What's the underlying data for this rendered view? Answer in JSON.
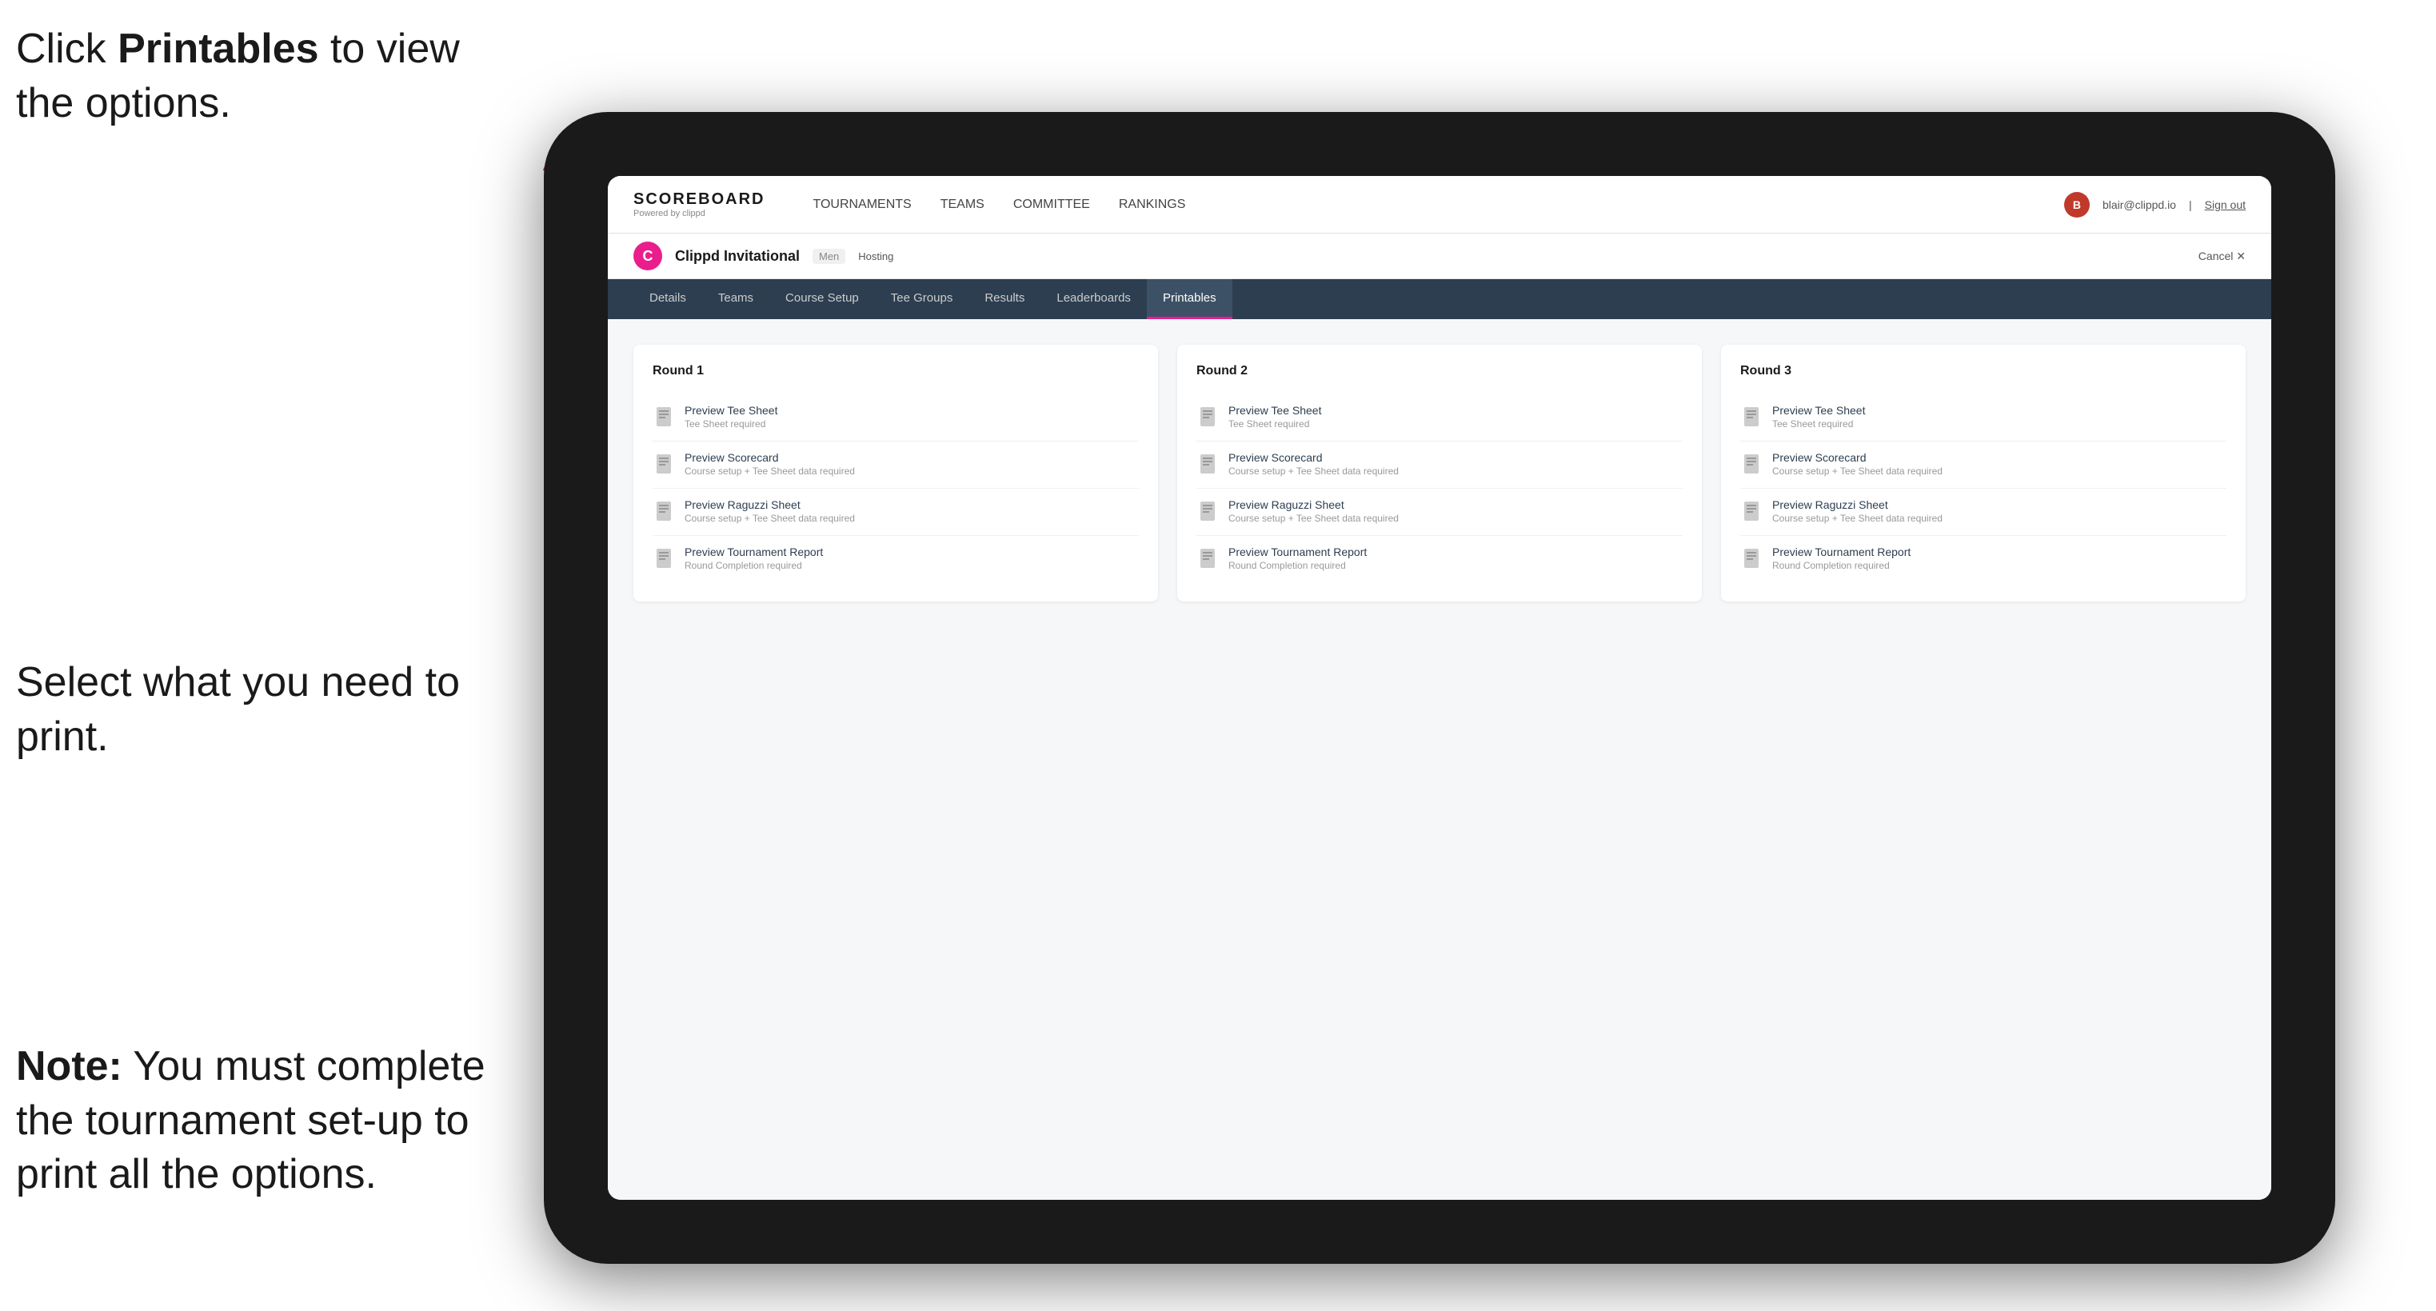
{
  "annotations": {
    "top": {
      "part1": "Click ",
      "bold": "Printables",
      "part2": " to view the options."
    },
    "middle": {
      "text": "Select what you need to print."
    },
    "bottom": {
      "bold": "Note:",
      "text": " You must complete the tournament set-up to print all the options."
    }
  },
  "nav": {
    "logo": "SCOREBOARD",
    "logo_sub": "Powered by clippd",
    "links": [
      {
        "label": "TOURNAMENTS",
        "active": false
      },
      {
        "label": "TEAMS",
        "active": false
      },
      {
        "label": "COMMITTEE",
        "active": false
      },
      {
        "label": "RANKINGS",
        "active": false
      }
    ],
    "user_email": "blair@clippd.io",
    "sign_out": "Sign out"
  },
  "tournament": {
    "logo_letter": "C",
    "name": "Clippd Invitational",
    "tag": "Men",
    "status": "Hosting",
    "cancel": "Cancel ✕"
  },
  "sub_tabs": [
    {
      "label": "Details",
      "active": false
    },
    {
      "label": "Teams",
      "active": false
    },
    {
      "label": "Course Setup",
      "active": false
    },
    {
      "label": "Tee Groups",
      "active": false
    },
    {
      "label": "Results",
      "active": false
    },
    {
      "label": "Leaderboards",
      "active": false
    },
    {
      "label": "Printables",
      "active": true
    }
  ],
  "rounds": [
    {
      "title": "Round 1",
      "items": [
        {
          "label": "Preview Tee Sheet",
          "sublabel": "Tee Sheet required"
        },
        {
          "label": "Preview Scorecard",
          "sublabel": "Course setup + Tee Sheet data required"
        },
        {
          "label": "Preview Raguzzi Sheet",
          "sublabel": "Course setup + Tee Sheet data required"
        },
        {
          "label": "Preview Tournament Report",
          "sublabel": "Round Completion required"
        }
      ]
    },
    {
      "title": "Round 2",
      "items": [
        {
          "label": "Preview Tee Sheet",
          "sublabel": "Tee Sheet required"
        },
        {
          "label": "Preview Scorecard",
          "sublabel": "Course setup + Tee Sheet data required"
        },
        {
          "label": "Preview Raguzzi Sheet",
          "sublabel": "Course setup + Tee Sheet data required"
        },
        {
          "label": "Preview Tournament Report",
          "sublabel": "Round Completion required"
        }
      ]
    },
    {
      "title": "Round 3",
      "items": [
        {
          "label": "Preview Tee Sheet",
          "sublabel": "Tee Sheet required"
        },
        {
          "label": "Preview Scorecard",
          "sublabel": "Course setup + Tee Sheet data required"
        },
        {
          "label": "Preview Raguzzi Sheet",
          "sublabel": "Course setup + Tee Sheet data required"
        },
        {
          "label": "Preview Tournament Report",
          "sublabel": "Round Completion required"
        }
      ]
    }
  ]
}
